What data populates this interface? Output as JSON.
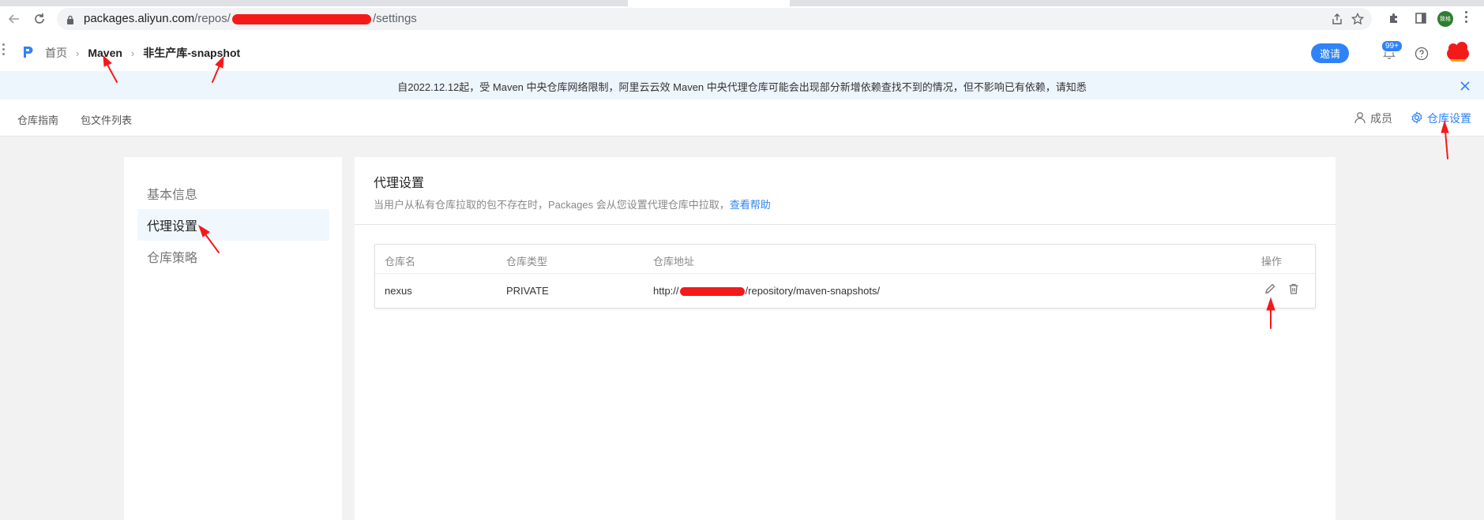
{
  "browser": {
    "url_host": "packages.aliyun.com",
    "url_path_prefix": "/repos/",
    "url_path_suffix": "/settings",
    "profile_initials": "致格"
  },
  "header": {
    "breadcrumbs": [
      "首页",
      "Maven",
      "非生产库-snapshot"
    ],
    "invite_label": "邀请",
    "notification_count": "99+"
  },
  "notice": {
    "text": "自2022.12.12起，受 Maven 中央仓库网络限制，阿里云云效 Maven 中央代理仓库可能会出现部分新增依赖查找不到的情况，但不影响已有依赖，请知悉"
  },
  "subnav": {
    "tabs": [
      "仓库指南",
      "包文件列表"
    ],
    "members_label": "成员",
    "settings_label": "仓库设置"
  },
  "sidebar": {
    "items": [
      "基本信息",
      "代理设置",
      "仓库策略"
    ],
    "active_index": 1
  },
  "proxy": {
    "title": "代理设置",
    "description": "当用户从私有仓库拉取的包不存在时，Packages 会从您设置代理仓库中拉取，",
    "help_link": "查看帮助",
    "columns": [
      "仓库名",
      "仓库类型",
      "仓库地址",
      "操作"
    ],
    "rows": [
      {
        "name": "nexus",
        "type": "PRIVATE",
        "url_prefix": "http://",
        "url_suffix": "/repository/maven-snapshots/"
      }
    ]
  },
  "colors": {
    "accent": "#2f83f6",
    "notice_bg": "#edf5fd",
    "annotation": "#f41a1a"
  },
  "icons": [
    "back-arrow-icon",
    "reload-icon",
    "lock-icon",
    "share-icon",
    "star-icon",
    "puzzle-icon",
    "sidepanel-icon",
    "app-logo-icon",
    "chevron-right-icon",
    "bell-icon",
    "help-circle-icon",
    "close-icon",
    "user-icon",
    "gear-icon",
    "edit-pencil-icon",
    "trash-icon"
  ]
}
